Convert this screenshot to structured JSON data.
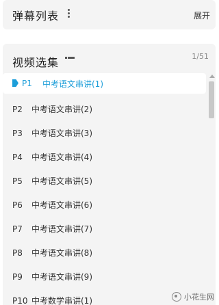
{
  "danmaku": {
    "title": "弹幕列表",
    "expand_label": "展开"
  },
  "episodes": {
    "title": "视频选集",
    "page_count": "1/51",
    "items": [
      {
        "num": "P1",
        "title": "中考语文串讲(1)",
        "active": true
      },
      {
        "num": "P2",
        "title": "中考语文串讲(2)"
      },
      {
        "num": "P3",
        "title": "中考语文串讲(3)"
      },
      {
        "num": "P4",
        "title": "中考语文串讲(4)"
      },
      {
        "num": "P5",
        "title": "中考语文串讲(5)"
      },
      {
        "num": "P6",
        "title": "中考语文串讲(6)"
      },
      {
        "num": "P7",
        "title": "中考语文串讲(7)"
      },
      {
        "num": "P8",
        "title": "中考语文串讲(8)"
      },
      {
        "num": "P9",
        "title": "中考语文串讲(9)"
      },
      {
        "num": "P10",
        "title": "中考数学串讲(1)"
      }
    ]
  },
  "watermark": {
    "text": "小花生网"
  },
  "colors": {
    "accent": "#1d9ed9",
    "panel_bg": "#f4f4f4"
  }
}
